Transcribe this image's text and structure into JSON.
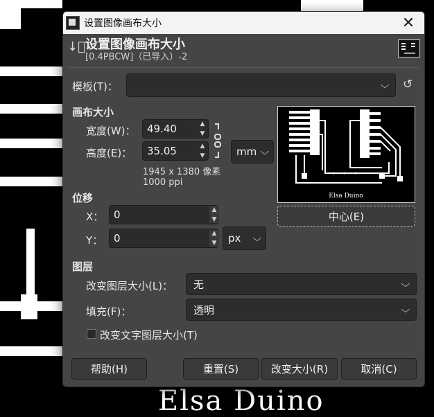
{
  "window": {
    "title": "设置图像画布大小",
    "close_glyph": "✕"
  },
  "header": {
    "title": "设置图像画布大小",
    "subtitle": "[0.4PBCW]（已导入）-2",
    "icon": "resize-canvas-icon"
  },
  "template": {
    "label": "模板(T)：",
    "value": "",
    "reset_icon": "reset-icon"
  },
  "canvas_size": {
    "heading": "画布大小",
    "width_label": "宽度(W)：",
    "width_value": "49.40",
    "height_label": "高度(E)：",
    "height_value": "35.05",
    "unit": "mm",
    "pixels": "1945 x 1380 像素",
    "resolution": "1000 ppi",
    "chain_icon": "chain-link-icon"
  },
  "preview": {
    "caption": "Elsa Duino",
    "center_button": "中心(E)"
  },
  "offset": {
    "heading": "位移",
    "x_label": "X：",
    "x_value": "0",
    "y_label": "Y：",
    "y_value": "0",
    "unit": "px"
  },
  "layers": {
    "heading": "图层",
    "resize_label": "改变图层大小(L)：",
    "resize_value": "无",
    "fill_label": "填充(F)：",
    "fill_value": "透明",
    "text_layers_label": "改变文字图层大小(T)",
    "text_layers_checked": false
  },
  "buttons": {
    "help": "帮助(H)",
    "reset": "重置(S)",
    "resize": "改变大小(R)",
    "cancel": "取消(C)"
  },
  "background": {
    "caption": "Elsa Duino"
  },
  "colors": {
    "dialog_bg": "#454545",
    "field_bg": "#2b2b2b",
    "titlebar_bg": "#f3f3f3"
  }
}
